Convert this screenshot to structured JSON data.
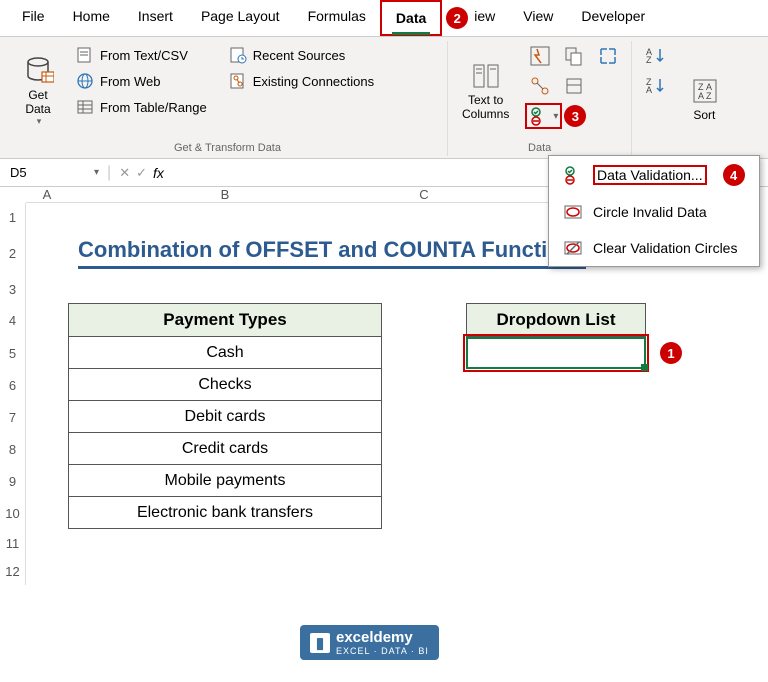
{
  "tabs": [
    "File",
    "Home",
    "Insert",
    "Page Layout",
    "Formulas",
    "Data",
    "Review",
    "View",
    "Developer"
  ],
  "ribbon": {
    "getData": "Get\nData",
    "fromTextCsv": "From Text/CSV",
    "fromWeb": "From Web",
    "fromTable": "From Table/Range",
    "recentSources": "Recent Sources",
    "existingConn": "Existing Connections",
    "groupGet": "Get & Transform Data",
    "textToCols": "Text to\nColumns",
    "groupData": "Data",
    "sort": "Sort"
  },
  "menu": {
    "dv": "Data Validation...",
    "circle": "Circle Invalid Data",
    "clear": "Clear Validation Circles"
  },
  "nameBox": "D5",
  "sheet": {
    "title": "Combination of OFFSET and COUNTA Functions",
    "headerB": "Payment Types",
    "headerD": "Dropdown List",
    "rows": [
      "Cash",
      "Checks",
      "Debit cards",
      "Credit cards",
      "Mobile payments",
      "Electronic bank transfers"
    ]
  },
  "badges": {
    "b1": "1",
    "b2": "2",
    "b3": "3",
    "b4": "4"
  },
  "wm": {
    "name": "exceldemy",
    "tag": "EXCEL · DATA · BI"
  }
}
